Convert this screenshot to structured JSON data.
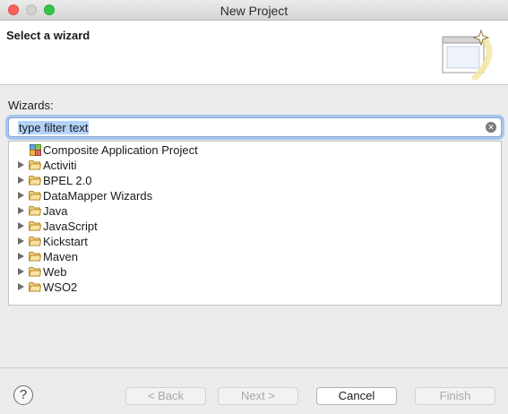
{
  "window": {
    "title": "New Project"
  },
  "header": {
    "title": "Select a wizard"
  },
  "wizards_label": "Wizards:",
  "filter": {
    "value": "type filter text"
  },
  "tree": {
    "items": [
      {
        "label": "Composite Application Project"
      },
      {
        "label": "Activiti"
      },
      {
        "label": "BPEL 2.0"
      },
      {
        "label": "DataMapper Wizards"
      },
      {
        "label": "Java"
      },
      {
        "label": "JavaScript"
      },
      {
        "label": "Kickstart"
      },
      {
        "label": "Maven"
      },
      {
        "label": "Web"
      },
      {
        "label": "WSO2"
      }
    ]
  },
  "buttons": {
    "help": "?",
    "back": "< Back",
    "next": "Next >",
    "cancel": "Cancel",
    "finish": "Finish"
  }
}
